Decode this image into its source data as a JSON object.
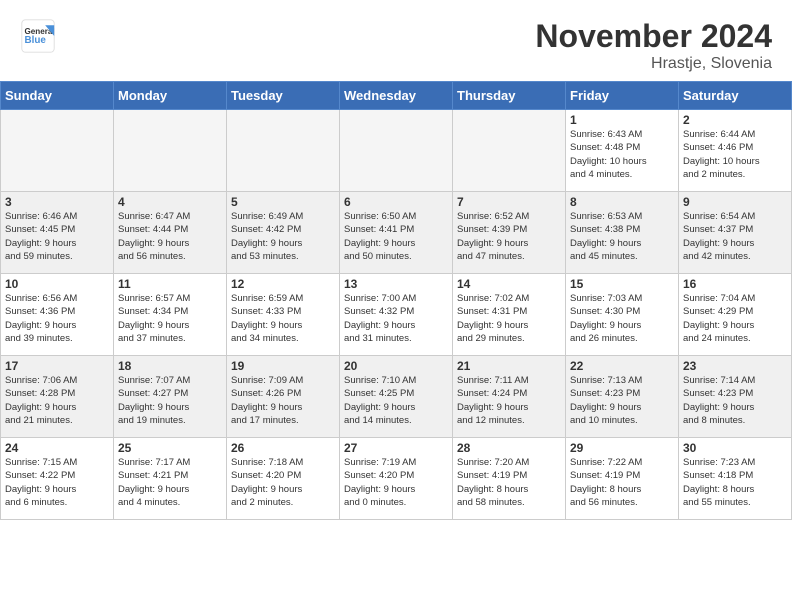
{
  "header": {
    "logo_general": "General",
    "logo_blue": "Blue",
    "month_title": "November 2024",
    "location": "Hrastje, Slovenia"
  },
  "days_of_week": [
    "Sunday",
    "Monday",
    "Tuesday",
    "Wednesday",
    "Thursday",
    "Friday",
    "Saturday"
  ],
  "weeks": [
    [
      {
        "day": "",
        "info": ""
      },
      {
        "day": "",
        "info": ""
      },
      {
        "day": "",
        "info": ""
      },
      {
        "day": "",
        "info": ""
      },
      {
        "day": "",
        "info": ""
      },
      {
        "day": "1",
        "info": "Sunrise: 6:43 AM\nSunset: 4:48 PM\nDaylight: 10 hours\nand 4 minutes."
      },
      {
        "day": "2",
        "info": "Sunrise: 6:44 AM\nSunset: 4:46 PM\nDaylight: 10 hours\nand 2 minutes."
      }
    ],
    [
      {
        "day": "3",
        "info": "Sunrise: 6:46 AM\nSunset: 4:45 PM\nDaylight: 9 hours\nand 59 minutes."
      },
      {
        "day": "4",
        "info": "Sunrise: 6:47 AM\nSunset: 4:44 PM\nDaylight: 9 hours\nand 56 minutes."
      },
      {
        "day": "5",
        "info": "Sunrise: 6:49 AM\nSunset: 4:42 PM\nDaylight: 9 hours\nand 53 minutes."
      },
      {
        "day": "6",
        "info": "Sunrise: 6:50 AM\nSunset: 4:41 PM\nDaylight: 9 hours\nand 50 minutes."
      },
      {
        "day": "7",
        "info": "Sunrise: 6:52 AM\nSunset: 4:39 PM\nDaylight: 9 hours\nand 47 minutes."
      },
      {
        "day": "8",
        "info": "Sunrise: 6:53 AM\nSunset: 4:38 PM\nDaylight: 9 hours\nand 45 minutes."
      },
      {
        "day": "9",
        "info": "Sunrise: 6:54 AM\nSunset: 4:37 PM\nDaylight: 9 hours\nand 42 minutes."
      }
    ],
    [
      {
        "day": "10",
        "info": "Sunrise: 6:56 AM\nSunset: 4:36 PM\nDaylight: 9 hours\nand 39 minutes."
      },
      {
        "day": "11",
        "info": "Sunrise: 6:57 AM\nSunset: 4:34 PM\nDaylight: 9 hours\nand 37 minutes."
      },
      {
        "day": "12",
        "info": "Sunrise: 6:59 AM\nSunset: 4:33 PM\nDaylight: 9 hours\nand 34 minutes."
      },
      {
        "day": "13",
        "info": "Sunrise: 7:00 AM\nSunset: 4:32 PM\nDaylight: 9 hours\nand 31 minutes."
      },
      {
        "day": "14",
        "info": "Sunrise: 7:02 AM\nSunset: 4:31 PM\nDaylight: 9 hours\nand 29 minutes."
      },
      {
        "day": "15",
        "info": "Sunrise: 7:03 AM\nSunset: 4:30 PM\nDaylight: 9 hours\nand 26 minutes."
      },
      {
        "day": "16",
        "info": "Sunrise: 7:04 AM\nSunset: 4:29 PM\nDaylight: 9 hours\nand 24 minutes."
      }
    ],
    [
      {
        "day": "17",
        "info": "Sunrise: 7:06 AM\nSunset: 4:28 PM\nDaylight: 9 hours\nand 21 minutes."
      },
      {
        "day": "18",
        "info": "Sunrise: 7:07 AM\nSunset: 4:27 PM\nDaylight: 9 hours\nand 19 minutes."
      },
      {
        "day": "19",
        "info": "Sunrise: 7:09 AM\nSunset: 4:26 PM\nDaylight: 9 hours\nand 17 minutes."
      },
      {
        "day": "20",
        "info": "Sunrise: 7:10 AM\nSunset: 4:25 PM\nDaylight: 9 hours\nand 14 minutes."
      },
      {
        "day": "21",
        "info": "Sunrise: 7:11 AM\nSunset: 4:24 PM\nDaylight: 9 hours\nand 12 minutes."
      },
      {
        "day": "22",
        "info": "Sunrise: 7:13 AM\nSunset: 4:23 PM\nDaylight: 9 hours\nand 10 minutes."
      },
      {
        "day": "23",
        "info": "Sunrise: 7:14 AM\nSunset: 4:23 PM\nDaylight: 9 hours\nand 8 minutes."
      }
    ],
    [
      {
        "day": "24",
        "info": "Sunrise: 7:15 AM\nSunset: 4:22 PM\nDaylight: 9 hours\nand 6 minutes."
      },
      {
        "day": "25",
        "info": "Sunrise: 7:17 AM\nSunset: 4:21 PM\nDaylight: 9 hours\nand 4 minutes."
      },
      {
        "day": "26",
        "info": "Sunrise: 7:18 AM\nSunset: 4:20 PM\nDaylight: 9 hours\nand 2 minutes."
      },
      {
        "day": "27",
        "info": "Sunrise: 7:19 AM\nSunset: 4:20 PM\nDaylight: 9 hours\nand 0 minutes."
      },
      {
        "day": "28",
        "info": "Sunrise: 7:20 AM\nSunset: 4:19 PM\nDaylight: 8 hours\nand 58 minutes."
      },
      {
        "day": "29",
        "info": "Sunrise: 7:22 AM\nSunset: 4:19 PM\nDaylight: 8 hours\nand 56 minutes."
      },
      {
        "day": "30",
        "info": "Sunrise: 7:23 AM\nSunset: 4:18 PM\nDaylight: 8 hours\nand 55 minutes."
      }
    ]
  ]
}
